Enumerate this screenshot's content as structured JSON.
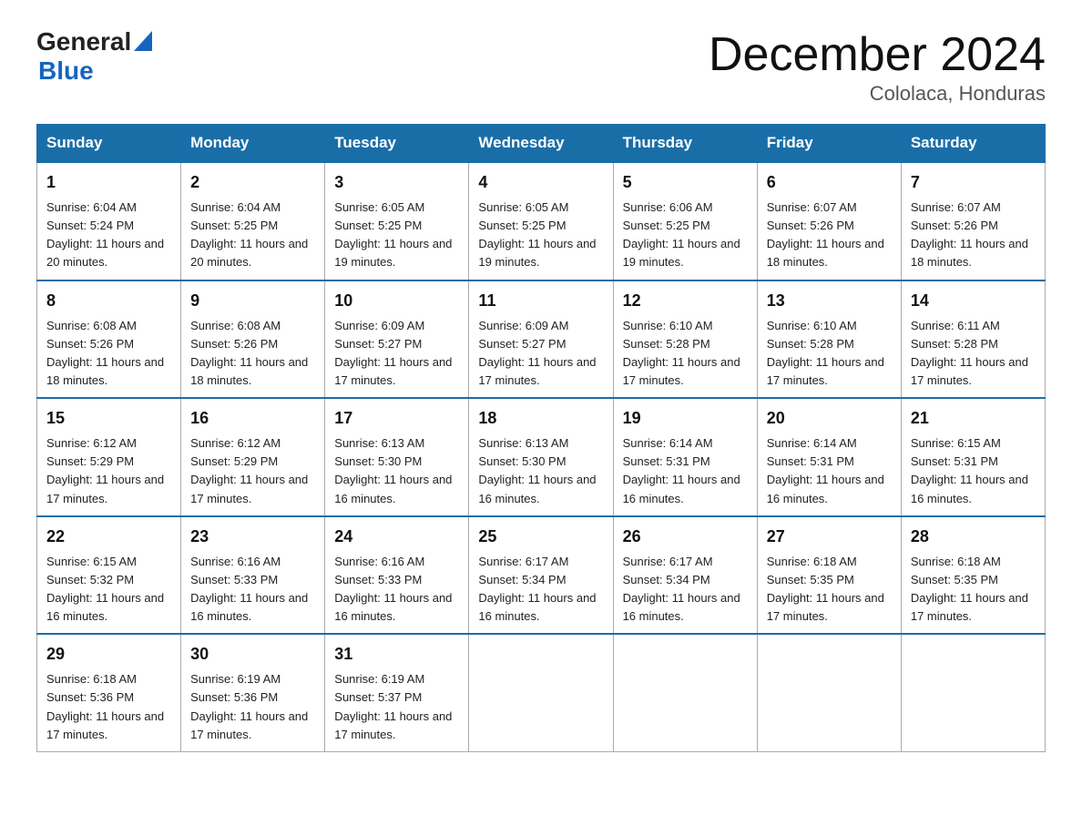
{
  "header": {
    "logo_general": "General",
    "logo_blue": "Blue",
    "month_year": "December 2024",
    "location": "Cololaca, Honduras"
  },
  "days_of_week": [
    "Sunday",
    "Monday",
    "Tuesday",
    "Wednesday",
    "Thursday",
    "Friday",
    "Saturday"
  ],
  "weeks": [
    [
      {
        "day": "1",
        "sunrise": "6:04 AM",
        "sunset": "5:24 PM",
        "daylight": "11 hours and 20 minutes."
      },
      {
        "day": "2",
        "sunrise": "6:04 AM",
        "sunset": "5:25 PM",
        "daylight": "11 hours and 20 minutes."
      },
      {
        "day": "3",
        "sunrise": "6:05 AM",
        "sunset": "5:25 PM",
        "daylight": "11 hours and 19 minutes."
      },
      {
        "day": "4",
        "sunrise": "6:05 AM",
        "sunset": "5:25 PM",
        "daylight": "11 hours and 19 minutes."
      },
      {
        "day": "5",
        "sunrise": "6:06 AM",
        "sunset": "5:25 PM",
        "daylight": "11 hours and 19 minutes."
      },
      {
        "day": "6",
        "sunrise": "6:07 AM",
        "sunset": "5:26 PM",
        "daylight": "11 hours and 18 minutes."
      },
      {
        "day": "7",
        "sunrise": "6:07 AM",
        "sunset": "5:26 PM",
        "daylight": "11 hours and 18 minutes."
      }
    ],
    [
      {
        "day": "8",
        "sunrise": "6:08 AM",
        "sunset": "5:26 PM",
        "daylight": "11 hours and 18 minutes."
      },
      {
        "day": "9",
        "sunrise": "6:08 AM",
        "sunset": "5:26 PM",
        "daylight": "11 hours and 18 minutes."
      },
      {
        "day": "10",
        "sunrise": "6:09 AM",
        "sunset": "5:27 PM",
        "daylight": "11 hours and 17 minutes."
      },
      {
        "day": "11",
        "sunrise": "6:09 AM",
        "sunset": "5:27 PM",
        "daylight": "11 hours and 17 minutes."
      },
      {
        "day": "12",
        "sunrise": "6:10 AM",
        "sunset": "5:28 PM",
        "daylight": "11 hours and 17 minutes."
      },
      {
        "day": "13",
        "sunrise": "6:10 AM",
        "sunset": "5:28 PM",
        "daylight": "11 hours and 17 minutes."
      },
      {
        "day": "14",
        "sunrise": "6:11 AM",
        "sunset": "5:28 PM",
        "daylight": "11 hours and 17 minutes."
      }
    ],
    [
      {
        "day": "15",
        "sunrise": "6:12 AM",
        "sunset": "5:29 PM",
        "daylight": "11 hours and 17 minutes."
      },
      {
        "day": "16",
        "sunrise": "6:12 AM",
        "sunset": "5:29 PM",
        "daylight": "11 hours and 17 minutes."
      },
      {
        "day": "17",
        "sunrise": "6:13 AM",
        "sunset": "5:30 PM",
        "daylight": "11 hours and 16 minutes."
      },
      {
        "day": "18",
        "sunrise": "6:13 AM",
        "sunset": "5:30 PM",
        "daylight": "11 hours and 16 minutes."
      },
      {
        "day": "19",
        "sunrise": "6:14 AM",
        "sunset": "5:31 PM",
        "daylight": "11 hours and 16 minutes."
      },
      {
        "day": "20",
        "sunrise": "6:14 AM",
        "sunset": "5:31 PM",
        "daylight": "11 hours and 16 minutes."
      },
      {
        "day": "21",
        "sunrise": "6:15 AM",
        "sunset": "5:31 PM",
        "daylight": "11 hours and 16 minutes."
      }
    ],
    [
      {
        "day": "22",
        "sunrise": "6:15 AM",
        "sunset": "5:32 PM",
        "daylight": "11 hours and 16 minutes."
      },
      {
        "day": "23",
        "sunrise": "6:16 AM",
        "sunset": "5:33 PM",
        "daylight": "11 hours and 16 minutes."
      },
      {
        "day": "24",
        "sunrise": "6:16 AM",
        "sunset": "5:33 PM",
        "daylight": "11 hours and 16 minutes."
      },
      {
        "day": "25",
        "sunrise": "6:17 AM",
        "sunset": "5:34 PM",
        "daylight": "11 hours and 16 minutes."
      },
      {
        "day": "26",
        "sunrise": "6:17 AM",
        "sunset": "5:34 PM",
        "daylight": "11 hours and 16 minutes."
      },
      {
        "day": "27",
        "sunrise": "6:18 AM",
        "sunset": "5:35 PM",
        "daylight": "11 hours and 17 minutes."
      },
      {
        "day": "28",
        "sunrise": "6:18 AM",
        "sunset": "5:35 PM",
        "daylight": "11 hours and 17 minutes."
      }
    ],
    [
      {
        "day": "29",
        "sunrise": "6:18 AM",
        "sunset": "5:36 PM",
        "daylight": "11 hours and 17 minutes."
      },
      {
        "day": "30",
        "sunrise": "6:19 AM",
        "sunset": "5:36 PM",
        "daylight": "11 hours and 17 minutes."
      },
      {
        "day": "31",
        "sunrise": "6:19 AM",
        "sunset": "5:37 PM",
        "daylight": "11 hours and 17 minutes."
      },
      null,
      null,
      null,
      null
    ]
  ]
}
